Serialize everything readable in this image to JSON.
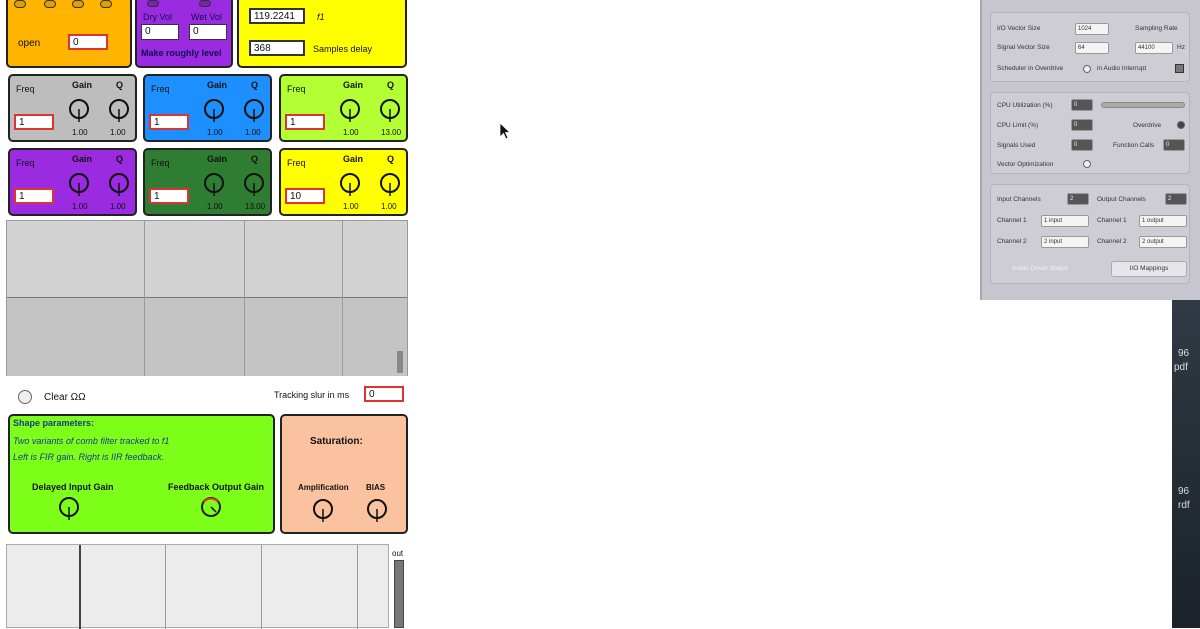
{
  "top_left": {
    "open_label": "open",
    "open_value": "0",
    "dry_label": "Dry Vol",
    "wet_label": "Wet Vol",
    "dry_value": "0",
    "wet_value": "0",
    "make_level": "Make roughly level",
    "pitch_value": "119.2241",
    "f1_label": "f1",
    "samples_value": "368",
    "samples_label": "Samples delay"
  },
  "filters": [
    {
      "freq_label": "Freq",
      "gain_label": "Gain",
      "q_label": "Q",
      "freq_value": "1",
      "gain_val": "1.00",
      "q_val": "1.00",
      "color": "#bdbdbd"
    },
    {
      "freq_label": "Freq",
      "gain_label": "Gain",
      "q_label": "Q",
      "freq_value": "1",
      "gain_val": "1.00",
      "q_val": "1.00",
      "color": "#1e8fff"
    },
    {
      "freq_label": "Freq",
      "gain_label": "Gain",
      "q_label": "Q",
      "freq_value": "1",
      "gain_val": "1.00",
      "q_val": "13.00",
      "color": "#b4ff33"
    },
    {
      "freq_label": "Freq",
      "gain_label": "Gain",
      "q_label": "Q",
      "freq_value": "1",
      "gain_val": "1.00",
      "q_val": "1.00",
      "color": "#9a2be0"
    },
    {
      "freq_label": "Freq",
      "gain_label": "Gain",
      "q_label": "Q",
      "freq_value": "1",
      "gain_val": "1.00",
      "q_val": "13.00",
      "color": "#2e7d32"
    },
    {
      "freq_label": "Freq",
      "gain_label": "Gain",
      "q_label": "Q",
      "freq_value": "10",
      "gain_val": "1.00",
      "q_val": "1.00",
      "color": "#ffff00"
    }
  ],
  "controls": {
    "clear_label": "Clear ΩΩ",
    "tracking_label": "Tracking slur in ms",
    "tracking_value": "0"
  },
  "shape": {
    "title": "Shape parameters:",
    "line1": "Two variants of comb filter tracked to f1",
    "line2": "Left is FIR gain. Right is IIR feedback.",
    "delayed_label": "Delayed Input Gain",
    "feedback_label": "Feedback Output Gain"
  },
  "saturation": {
    "title": "Saturation:",
    "amp_label": "Amplification",
    "bias_label": "BIAS"
  },
  "bottom": {
    "out_label": "out"
  },
  "dsp": {
    "io_vector_label": "I/O Vector Size",
    "io_vector_value": "1024",
    "sampling_label": "Sampling Rate",
    "signal_vector_label": "Signal Vector Size",
    "signal_vector_value": "64",
    "sampling_value": "44100",
    "hz": "Hz",
    "scheduler_label": "Scheduler in Overdrive",
    "in_audio_label": "in Audio Interrupt",
    "cpu_util_label": "CPU Utilization (%)",
    "cpu_util_value": "0",
    "cpu_limit_label": "CPU Limit (%)",
    "cpu_limit_value": "0",
    "overdrive_label": "Overdrive",
    "signals_used_label": "Signals Used",
    "signals_used_value": "0",
    "function_calls_label": "Function Calls",
    "function_calls_value": "0",
    "vector_opt_label": "Vector Optimization",
    "input_channels_label": "Input Channels",
    "input_channels_value": "2",
    "output_channels_label": "Output Channels",
    "output_channels_value": "2",
    "channel1_label": "Channel 1",
    "channel2_label": "Channel 2",
    "in1": "1 input",
    "in2": "2 input",
    "out1": "1 output",
    "out2": "2 output",
    "audio_status": "Audio Driver Status",
    "io_mappings": "I/O Mappings"
  },
  "side_text": {
    "a": "96",
    "b": "pdf",
    "c": "96",
    "d": "rdf"
  }
}
